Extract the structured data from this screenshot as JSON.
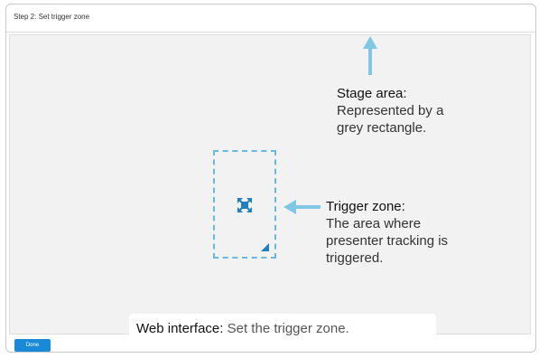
{
  "header": {
    "title": "Step 2: Set trigger zone"
  },
  "stage_callout": {
    "title": "Stage area:",
    "description_line1": "Represented by a",
    "description_line2": "grey rectangle."
  },
  "trigger_callout": {
    "title": "Trigger zone:",
    "description_line1": "The area where",
    "description_line2": "presenter tracking is",
    "description_line3": "triggered."
  },
  "buttons": {
    "done_label": "Done"
  },
  "caption": {
    "label": "Web interface:",
    "text": "Set the trigger zone."
  },
  "icons": {
    "move": "move-arrows-icon",
    "resize": "resize-handle-icon"
  },
  "colors": {
    "accent": "#1a8ad8",
    "callout_arrow": "#7fc7e3",
    "trigger_border": "#68b8e0",
    "stage_fill": "#f2f2f2"
  }
}
